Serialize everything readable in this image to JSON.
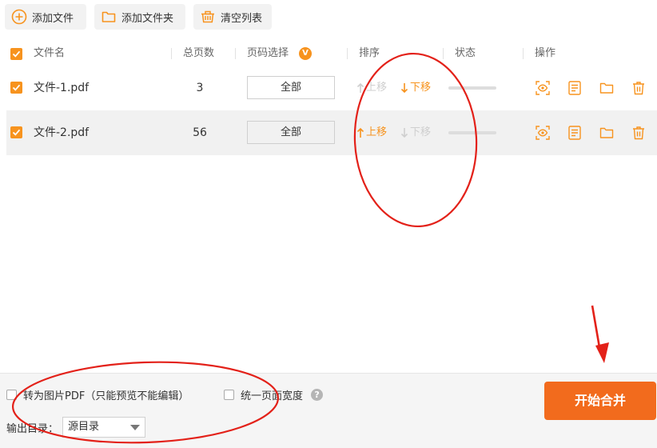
{
  "toolbar": {
    "add_file": "添加文件",
    "add_folder": "添加文件夹",
    "clear_list": "清空列表"
  },
  "table": {
    "headers": {
      "filename": "文件名",
      "pages": "总页数",
      "page_select": "页码选择",
      "page_select_badge": "V",
      "order": "排序",
      "status": "状态",
      "actions": "操作"
    },
    "rows": [
      {
        "filename": "文件-1.pdf",
        "pages": "3",
        "page_select": "全部",
        "move_up": "上移",
        "move_down": "下移",
        "up_enabled": false,
        "down_enabled": true
      },
      {
        "filename": "文件-2.pdf",
        "pages": "56",
        "page_select": "全部",
        "move_up": "上移",
        "move_down": "下移",
        "up_enabled": true,
        "down_enabled": false
      }
    ]
  },
  "options": {
    "to_image_pdf": "转为图片PDF（只能预览不能编辑）",
    "unify_width": "统一页面宽度",
    "help": "?",
    "output_label": "输出目录：",
    "output_value": "源目录",
    "start_button": "开始合并"
  },
  "colors": {
    "accent": "#f7931e",
    "start_button": "#f26b1d",
    "annotation": "#e32119"
  }
}
